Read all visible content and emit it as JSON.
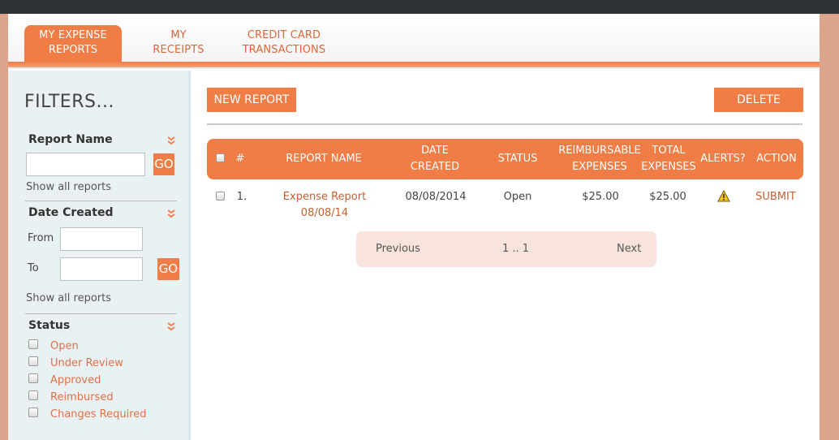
{
  "tabs": [
    {
      "line1": "MY EXPENSE",
      "line2": "REPORTS",
      "active": true
    },
    {
      "line1": "MY",
      "line2": "RECEIPTS",
      "active": false
    },
    {
      "line1": "CREDIT CARD",
      "line2": "TRANSACTIONS",
      "active": false
    }
  ],
  "sidebar": {
    "title": "FILTERS...",
    "report_name": {
      "title": "Report Name",
      "go": "GO",
      "show_all": "Show all reports"
    },
    "date_created": {
      "title": "Date Created",
      "from": "From",
      "to": "To",
      "go": "GO",
      "show_all": "Show all reports"
    },
    "status": {
      "title": "Status",
      "options": [
        "Open",
        "Under Review",
        "Approved",
        "Reimbursed",
        "Changes Required"
      ]
    }
  },
  "toolbar": {
    "new_report": "NEW REPORT",
    "delete": "DELETE"
  },
  "table": {
    "headers": {
      "num": "#",
      "report_name": "REPORT NAME",
      "date_created_1": "DATE",
      "date_created_2": "CREATED",
      "status": "STATUS",
      "reimb_1": "REIMBURSABLE",
      "reimb_2": "EXPENSES",
      "total_1": "TOTAL",
      "total_2": "EXPENSES",
      "alerts": "ALERTS?",
      "action": "ACTION"
    },
    "rows": [
      {
        "num": "1.",
        "report_name": "Expense Report 08/08/14",
        "date_created": "08/08/2014",
        "status": "Open",
        "reimbursable": "$25.00",
        "total": "$25.00",
        "action": "SUBMIT"
      }
    ]
  },
  "pager": {
    "previous": "Previous",
    "pages": "1 .. 1",
    "next": "Next"
  },
  "colors": {
    "accent": "#f07c46",
    "background": "#dba58d",
    "sidebar": "#eaf1f3",
    "topbar": "#2f3235"
  },
  "icons": {
    "alert": "warning-icon",
    "collapse": "chevron-down-icon"
  }
}
